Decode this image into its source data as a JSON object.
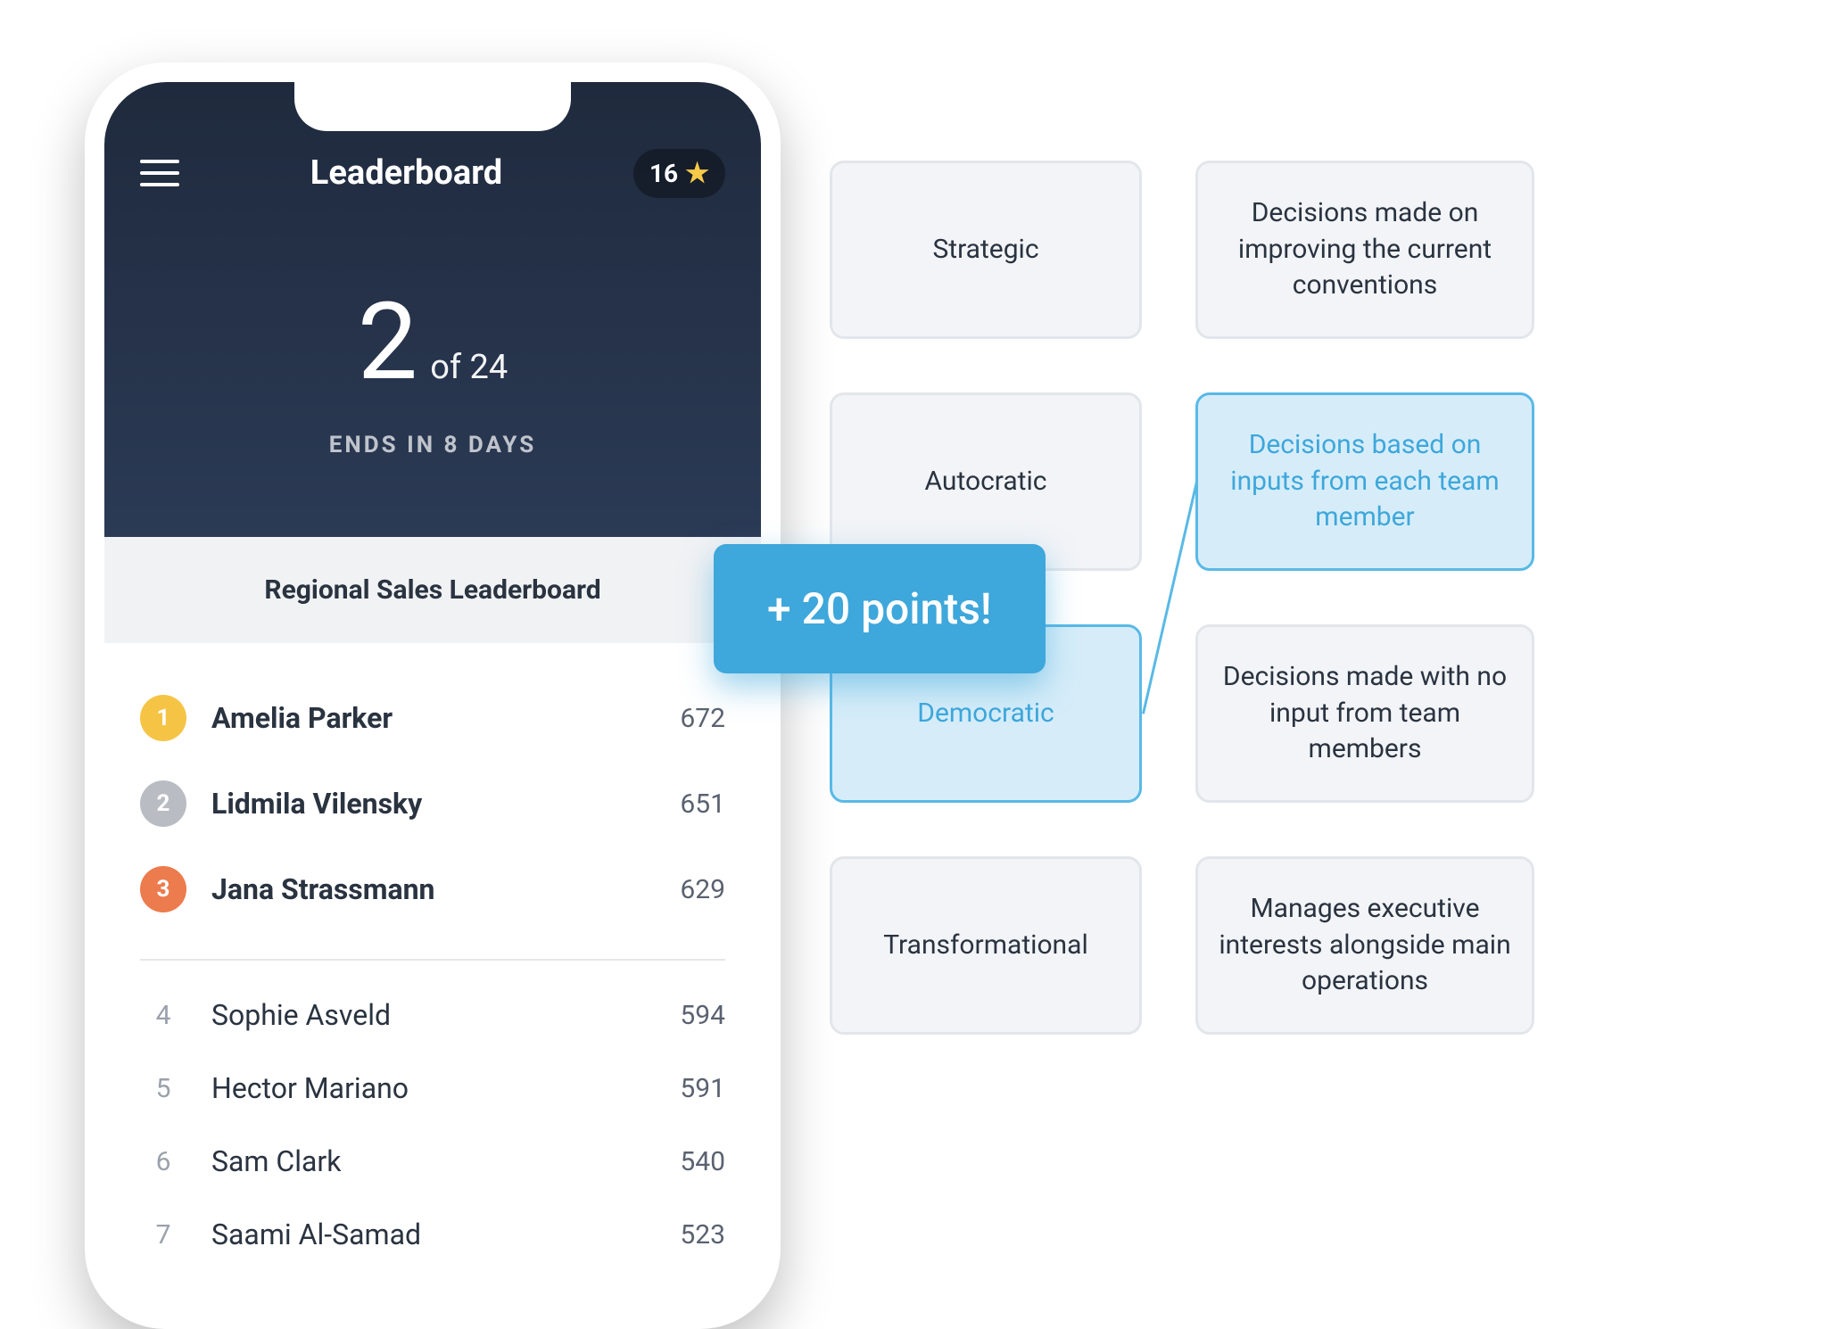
{
  "header": {
    "title": "Leaderboard",
    "star_count": "16",
    "rank_number": "2",
    "rank_of": "of 24",
    "ends_in": "ENDS IN 8 DAYS"
  },
  "section_title": "Regional Sales Leaderboard",
  "toast": "+ 20 points!",
  "leaders_top": [
    {
      "rank": "1",
      "name": "Amelia Parker",
      "score": "672"
    },
    {
      "rank": "2",
      "name": "Lidmila Vilensky",
      "score": "651"
    },
    {
      "rank": "3",
      "name": "Jana Strassmann",
      "score": "629"
    }
  ],
  "leaders_rest": [
    {
      "rank": "4",
      "name": "Sophie Asveld",
      "score": "594"
    },
    {
      "rank": "5",
      "name": "Hector Mariano",
      "score": "591"
    },
    {
      "rank": "6",
      "name": "Sam Clark",
      "score": "540"
    },
    {
      "rank": "7",
      "name": "Saami Al-Samad",
      "score": "523"
    }
  ],
  "match": {
    "left": [
      {
        "label": "Strategic",
        "selected": false
      },
      {
        "label": "Autocratic",
        "selected": false
      },
      {
        "label": "Democratic",
        "selected": true
      },
      {
        "label": "Transformational",
        "selected": false
      }
    ],
    "right": [
      {
        "label": "Decisions made on improving the current conventions",
        "selected": false
      },
      {
        "label": "Decisions based on inputs from each team member",
        "selected": true
      },
      {
        "label": "Decisions made with no input from team members",
        "selected": false
      },
      {
        "label": "Manages executive interests alongside main operations",
        "selected": false
      }
    ]
  }
}
